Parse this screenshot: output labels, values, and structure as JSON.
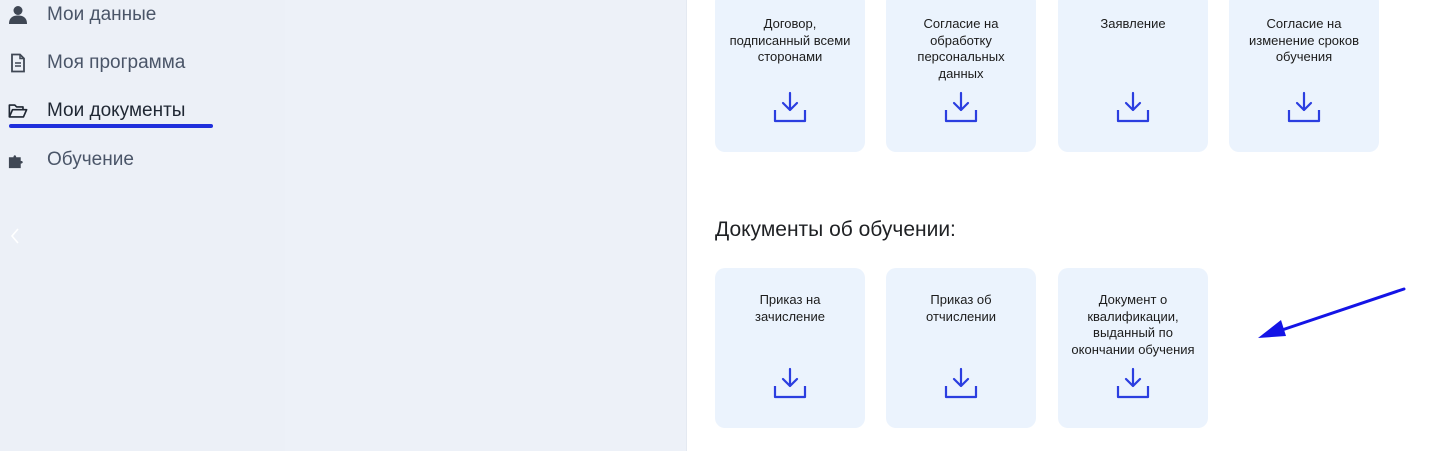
{
  "sidebar": {
    "items": [
      {
        "label": "Мои данные",
        "icon": "user-icon",
        "active": false
      },
      {
        "label": "Моя программа",
        "icon": "document-icon",
        "active": false
      },
      {
        "label": "Мои документы",
        "icon": "folder-open-icon",
        "active": true
      },
      {
        "label": "Обучение",
        "icon": "puzzle-icon",
        "active": false
      }
    ],
    "collapse_icon": "chevron-left-icon"
  },
  "top_documents": [
    {
      "label": "Договор, подписанный всеми сторонами",
      "icon": "download-icon"
    },
    {
      "label": "Согласие на обработку персональных данных",
      "icon": "download-icon"
    },
    {
      "label": "Заявление",
      "icon": "download-icon"
    },
    {
      "label": "Согласие на изменение сроков обучения",
      "icon": "download-icon"
    }
  ],
  "training_section": {
    "title": "Документы об обучении:",
    "documents": [
      {
        "label": "Приказ на зачисление",
        "icon": "download-icon"
      },
      {
        "label": "Приказ об отчислении",
        "icon": "download-icon"
      },
      {
        "label": "Документ о квалификации, выданный по окончании обучения",
        "icon": "download-icon"
      }
    ]
  },
  "colors": {
    "accent": "#1f2fdc",
    "icon_blue": "#2b3ee0",
    "card_bg": "#ebf3fd",
    "sidebar_bg": "#edf1f8",
    "annotation_arrow": "#1414e6"
  }
}
